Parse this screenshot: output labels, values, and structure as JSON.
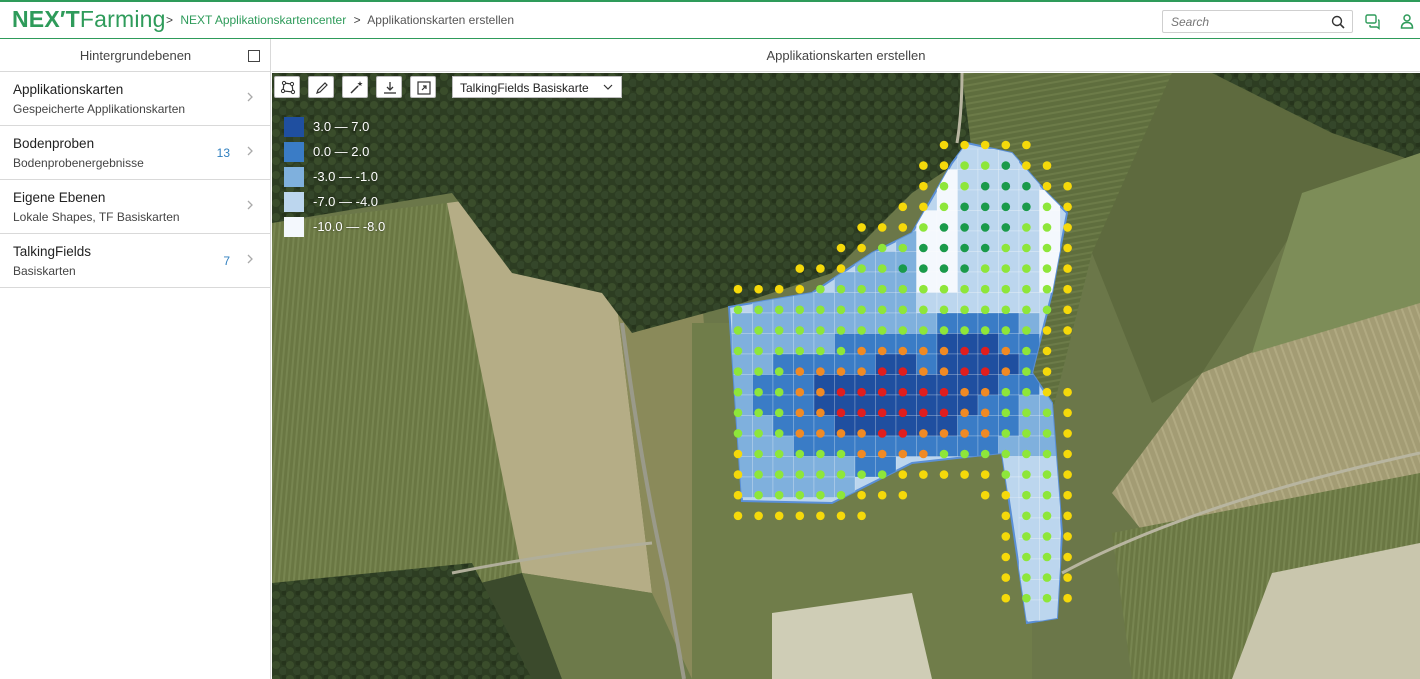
{
  "header": {
    "logo_next": "NEX′T",
    "logo_farming": "Farming",
    "breadcrumb": [
      ">",
      "NEXT Applikationskartencenter",
      ">",
      "Applikationskarten erstellen"
    ],
    "search_placeholder": "Search"
  },
  "sidebar": {
    "title": "Hintergrundebenen",
    "items": [
      {
        "title": "Applikationskarten",
        "subtitle": "Gespeicherte Applikationskarten",
        "count": ""
      },
      {
        "title": "Bodenproben",
        "subtitle": "Bodenprobenergebnisse",
        "count": "13"
      },
      {
        "title": "Eigene Ebenen",
        "subtitle": "Lokale Shapes, TF Basiskarten",
        "count": ""
      },
      {
        "title": "TalkingFields",
        "subtitle": "Basiskarten",
        "count": "7"
      }
    ]
  },
  "main": {
    "title": "Applikationskarten erstellen",
    "toolbar": [
      "draw-polygon-icon",
      "edit-icon",
      "magic-wand-icon",
      "download-icon",
      "export-map-icon"
    ],
    "layer_select": "TalkingFields Basiskarte",
    "legend": [
      {
        "label": "3.0 — 7.0",
        "color": "#1f4fa0"
      },
      {
        "label": "0.0 — 2.0",
        "color": "#3a7cc6"
      },
      {
        "label": "-3.0 — -1.0",
        "color": "#7fb0dd"
      },
      {
        "label": "-7.0 — -4.0",
        "color": "#bcd6ee"
      },
      {
        "label": "-10.0 — -8.0",
        "color": "#f4f8fd"
      }
    ]
  },
  "colors": {
    "brand": "#2e9b5a",
    "count": "#2f7fbf",
    "dot_yellow": "#f5d90a",
    "dot_lightgreen": "#8ee63a",
    "dot_darkgreen": "#1a9a4a",
    "dot_orange": "#f08a24",
    "dot_red": "#e01e1e"
  }
}
